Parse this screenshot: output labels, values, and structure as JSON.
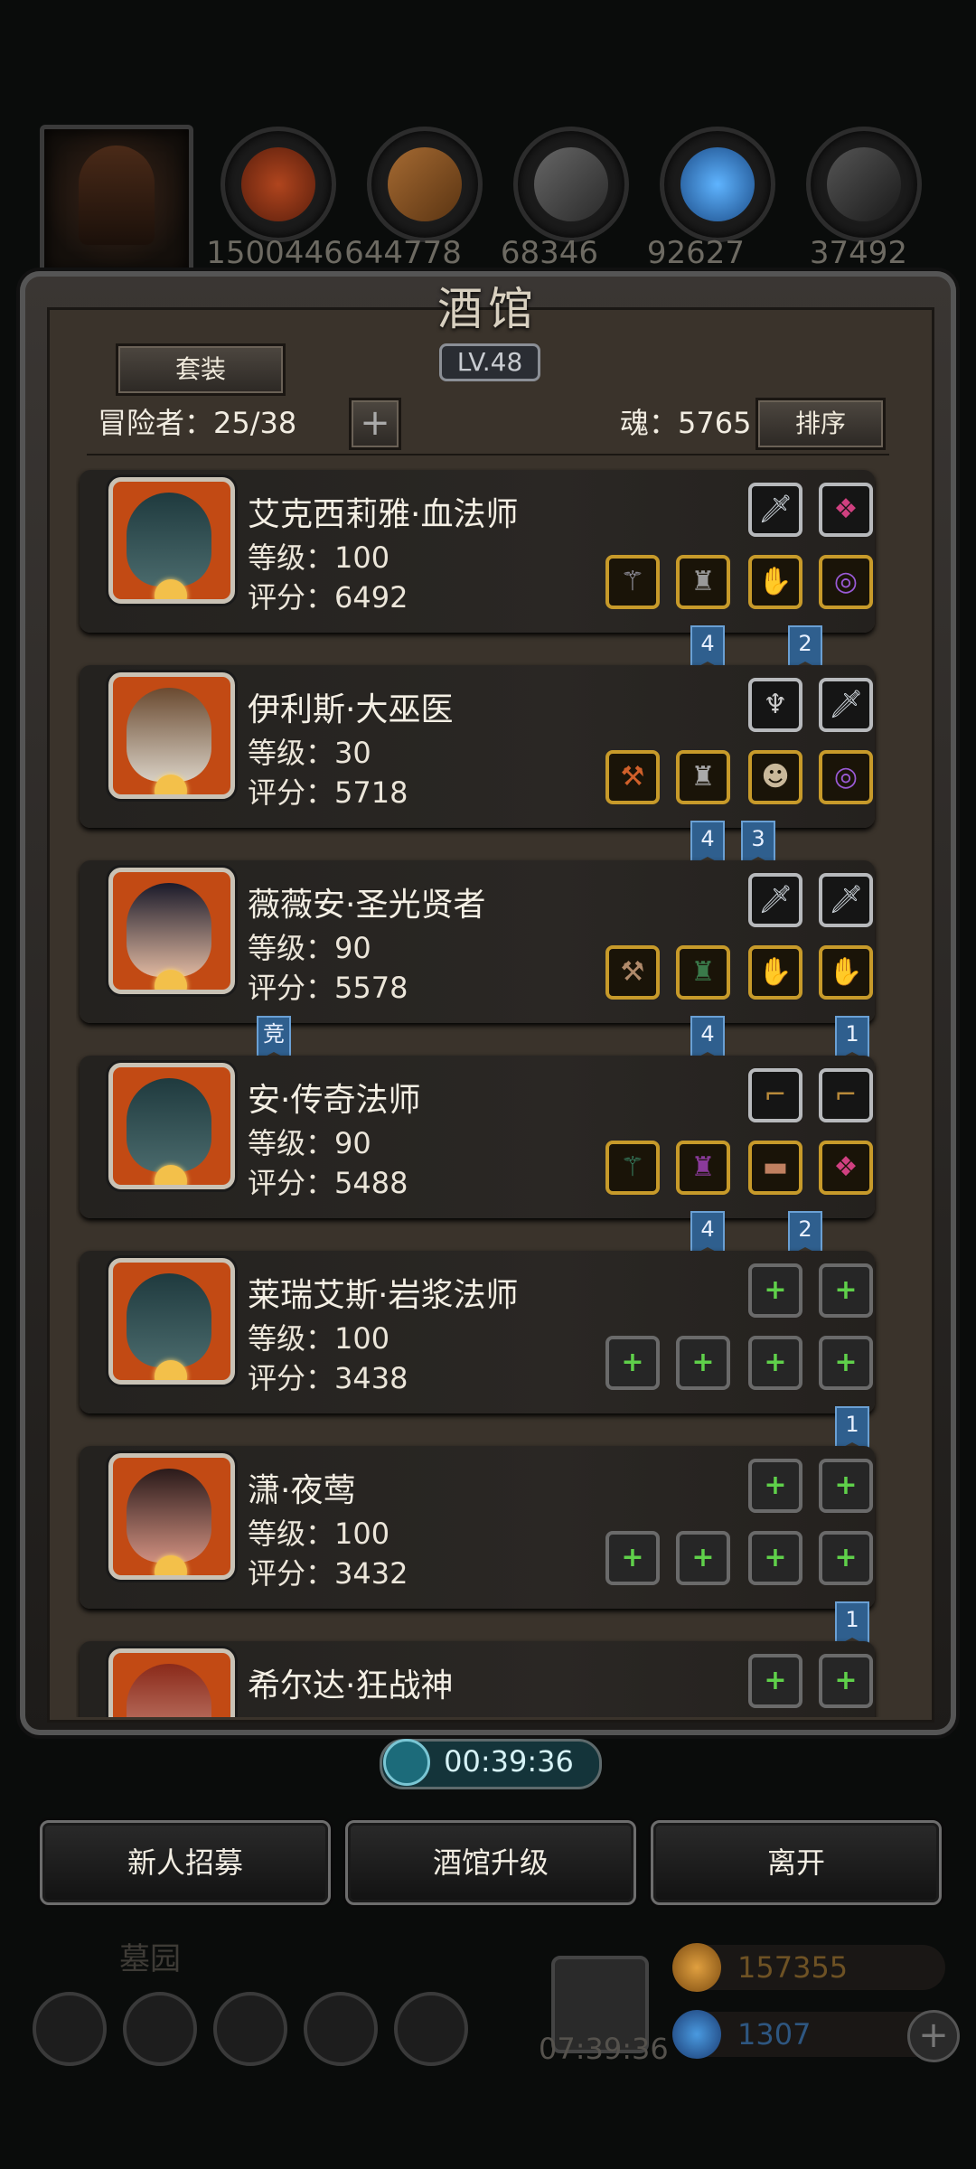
{
  "resources": [
    "1500446",
    "644778",
    "68346",
    "92627",
    "37492"
  ],
  "tavern": {
    "title": "酒馆",
    "level": "LV.48"
  },
  "toolbar": {
    "suit_label": "套装",
    "adventurers_label": "冒险者：25/38",
    "plus_label": "+",
    "soul_label": "魂：5765",
    "sort_label": "排序"
  },
  "heroes": [
    {
      "name": "艾克西莉雅·血法师",
      "level": "等级：100",
      "score": "评分：6492",
      "flags": [
        "4",
        "2"
      ]
    },
    {
      "name": "伊利斯·大巫医",
      "level": "等级：30",
      "score": "评分：5718",
      "flags": [
        "4",
        "3"
      ]
    },
    {
      "name": "薇薇安·圣光贤者",
      "level": "等级：90",
      "score": "评分：5578",
      "flags": [
        "竞",
        "4",
        "1"
      ]
    },
    {
      "name": "安·传奇法师",
      "level": "等级：90",
      "score": "评分：5488",
      "flags": [
        "4",
        "2"
      ]
    },
    {
      "name": "莱瑞艾斯·岩浆法师",
      "level": "等级：100",
      "score": "评分：3438",
      "flags": [
        "1"
      ]
    },
    {
      "name": "潇·夜莺",
      "level": "等级：100",
      "score": "评分：3432",
      "flags": [
        "1"
      ]
    },
    {
      "name": "希尔达·狂战神",
      "level": "",
      "score": "",
      "flags": []
    }
  ],
  "timer": "00:39:36",
  "actions": {
    "recruit": "新人招募",
    "upgrade": "酒馆升级",
    "leave": "离开"
  },
  "footer": {
    "cemetery": "墓园",
    "gift_timer": "07:39:36",
    "gold": "157355",
    "gems": "1307"
  },
  "colors": {
    "gold_value": "#b5822a",
    "gem_value": "#3f7fc8",
    "accent_blue": "#2f5f8e"
  }
}
